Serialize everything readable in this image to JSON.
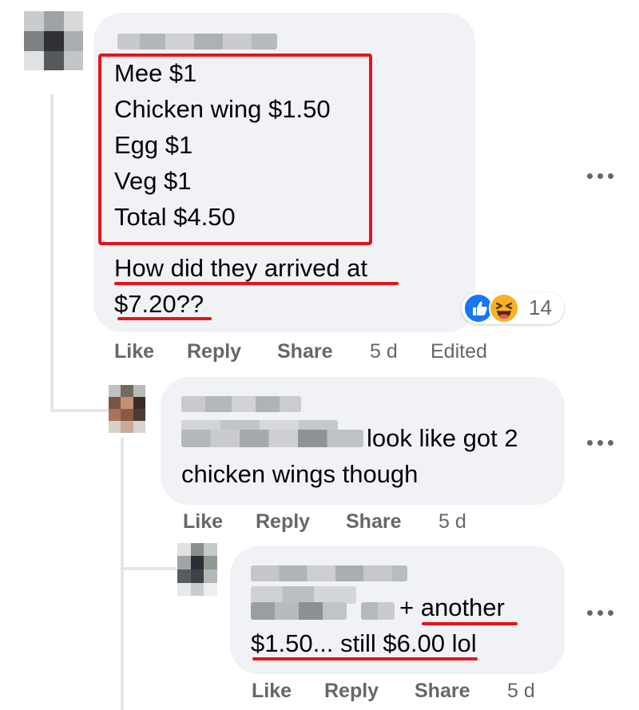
{
  "comment_main": {
    "lines": [
      "Mee $1",
      "Chicken wing $1.50",
      "Egg $1",
      "Veg $1",
      "Total $4.50"
    ],
    "question_line1": "How did they arrived at",
    "question_line2": "$7.20??",
    "reaction_count": "14",
    "actions": {
      "like": "Like",
      "reply": "Reply",
      "share": "Share",
      "time": "5 d",
      "edited": "Edited"
    }
  },
  "reply_1": {
    "text_line1": "look like got 2",
    "text_line2": "chicken wings though",
    "actions": {
      "like": "Like",
      "reply": "Reply",
      "share": "Share",
      "time": "5 d"
    }
  },
  "reply_2": {
    "text_line1_part1": "+ ",
    "text_line1_part2": "another",
    "text_line2_part1": "$1.50... still $6.00",
    "text_line2_part2": " lol",
    "actions": {
      "like": "Like",
      "reply": "Reply",
      "share": "Share",
      "time": "5 d"
    }
  },
  "colors": {
    "bubble": "#f0f2f5",
    "meta_text": "#65676b",
    "annotation_red": "#e5141b",
    "like_blue": "#1877f2",
    "haha_yellow": "#f7b125"
  },
  "icons": [
    "more-options-icon",
    "like-reaction-icon",
    "haha-reaction-icon"
  ]
}
